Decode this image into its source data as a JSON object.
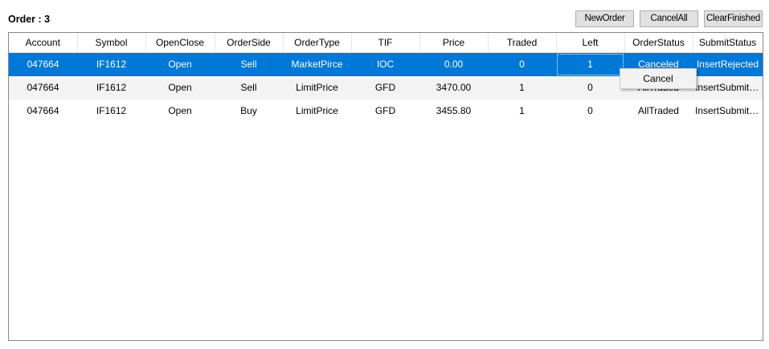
{
  "header": {
    "order_label": "Order : 3"
  },
  "toolbar": {
    "new_order_label": "NewOrder",
    "cancel_all_label": "CancelAll",
    "clear_finished_label": "ClearFinished"
  },
  "grid": {
    "columns": [
      "Account",
      "Symbol",
      "OpenClose",
      "OrderSide",
      "OrderType",
      "TIF",
      "Price",
      "Traded",
      "Left",
      "OrderStatus",
      "SubmitStatus"
    ],
    "rows": [
      [
        "047664",
        "IF1612",
        "Open",
        "Sell",
        "MarketPirce",
        "IOC",
        "0.00",
        "0",
        "1",
        "Canceled",
        "InsertRejected"
      ],
      [
        "047664",
        "IF1612",
        "Open",
        "Sell",
        "LimitPrice",
        "GFD",
        "3470.00",
        "1",
        "0",
        "AllTraded",
        "InsertSubmitted"
      ],
      [
        "047664",
        "IF1612",
        "Open",
        "Buy",
        "LimitPrice",
        "GFD",
        "3455.80",
        "1",
        "0",
        "AllTraded",
        "InsertSubmitted"
      ]
    ],
    "selected_row": 0
  },
  "context_menu": {
    "cancel_label": "Cancel"
  },
  "colors": {
    "selection": "#0078d7",
    "alt_row": "#f3f3f3"
  }
}
